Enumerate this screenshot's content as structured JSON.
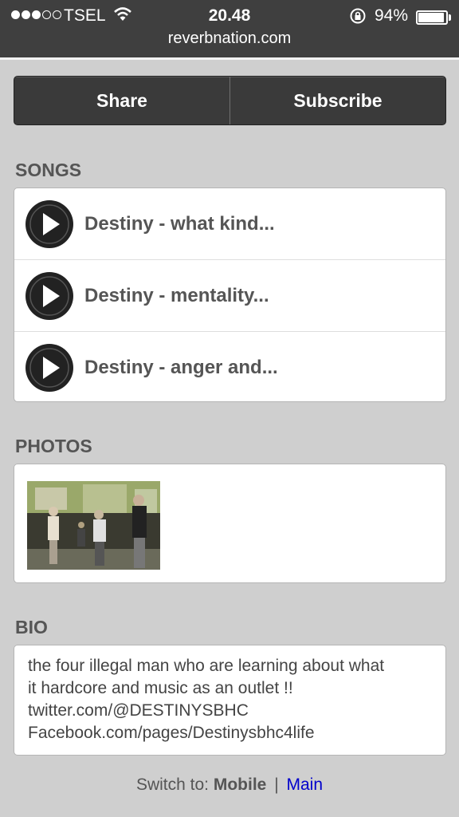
{
  "status_bar": {
    "carrier": "TSEL",
    "time": "20.48",
    "battery_percent": "94%",
    "battery_level": 0.94,
    "url": "reverbnation.com"
  },
  "actions": {
    "share_label": "Share",
    "subscribe_label": "Subscribe"
  },
  "songs": {
    "title": "SONGS",
    "items": [
      {
        "title": "Destiny - what kind..."
      },
      {
        "title": "Destiny - mentality..."
      },
      {
        "title": "Destiny - anger and..."
      }
    ]
  },
  "photos": {
    "title": "PHOTOS"
  },
  "bio": {
    "title": "BIO",
    "lines": [
      "the four illegal man who are learning about what",
      "it hardcore and music as an outlet !!",
      "twitter.com/@DESTINYSBHC",
      "Facebook.com/pages/Destinysbhc4life"
    ]
  },
  "footer": {
    "switch_label": "Switch to:",
    "mobile_label": "Mobile",
    "separator": "|",
    "main_label": "Main"
  }
}
